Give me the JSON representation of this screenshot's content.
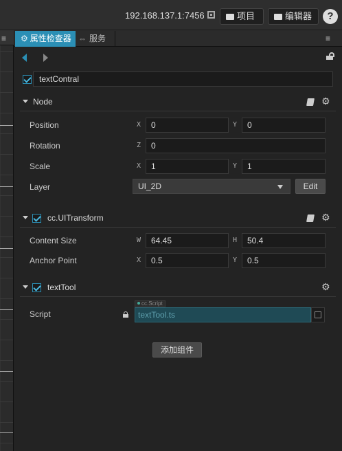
{
  "topbar": {
    "address": "192.168.137.1:7456",
    "project_label": "项目",
    "editor_label": "编辑器",
    "help_label": "?"
  },
  "tabs": [
    {
      "label": "属性检查器",
      "icon": "gear-icon",
      "active": true
    },
    {
      "label": "服务",
      "icon": "link-icon",
      "active": false
    }
  ],
  "menu_glyph": "≡",
  "node_name": {
    "value": "textContral",
    "enabled": true
  },
  "node_section": {
    "title": "Node",
    "position": {
      "label": "Position",
      "x_axis": "X",
      "x": "0",
      "y_axis": "Y",
      "y": "0"
    },
    "rotation": {
      "label": "Rotation",
      "z_axis": "Z",
      "z": "0"
    },
    "scale": {
      "label": "Scale",
      "x_axis": "X",
      "x": "1",
      "y_axis": "Y",
      "y": "1"
    },
    "layer": {
      "label": "Layer",
      "value": "UI_2D",
      "edit_label": "Edit"
    }
  },
  "ui_transform": {
    "title": "cc.UITransform",
    "enabled": true,
    "content_size": {
      "label": "Content Size",
      "w_axis": "W",
      "w": "64.45",
      "h_axis": "H",
      "h": "50.4"
    },
    "anchor_point": {
      "label": "Anchor Point",
      "x_axis": "X",
      "x": "0.5",
      "y_axis": "Y",
      "y": "0.5"
    }
  },
  "text_tool": {
    "title": "textTool",
    "enabled": true,
    "script_label": "Script",
    "script_type": "cc.Script",
    "script_value": "textTool.ts"
  },
  "add_component_label": "添加组件",
  "colors": {
    "accent": "#2b8fb5",
    "background": "#232323",
    "script_field": "#1f4a55"
  }
}
